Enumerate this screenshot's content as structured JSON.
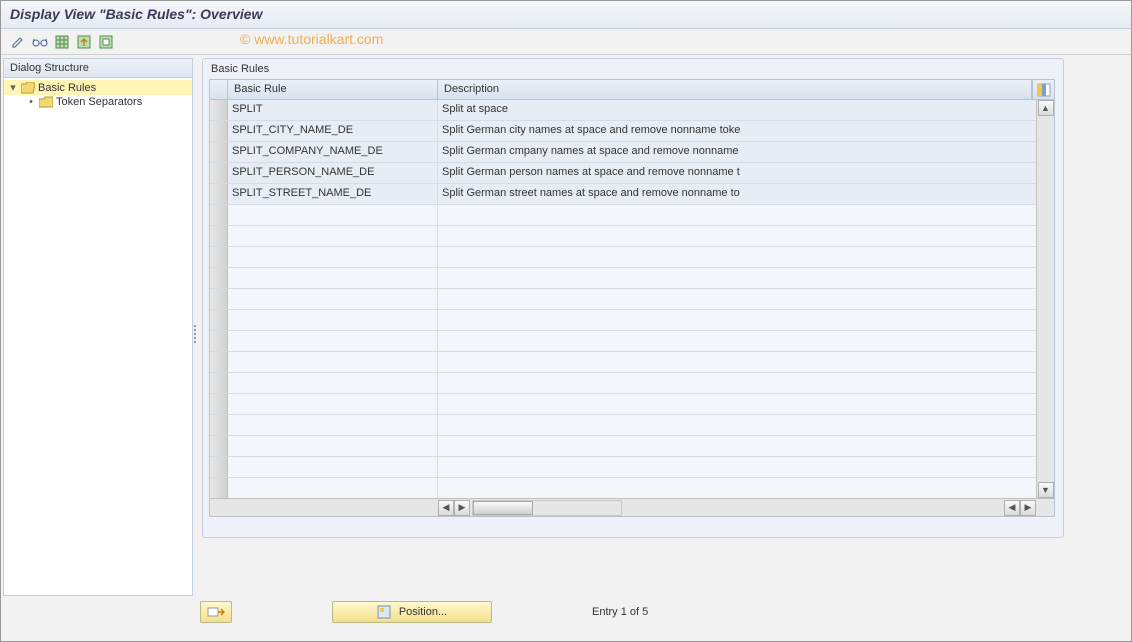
{
  "title": "Display View \"Basic Rules\": Overview",
  "watermark": "© www.tutorialkart.com",
  "toolbar_icons": [
    "edit-icon",
    "glasses-icon",
    "table-select-icon",
    "table-export-icon",
    "table-settings-icon"
  ],
  "tree": {
    "header": "Dialog Structure",
    "nodes": [
      {
        "label": "Basic Rules",
        "expanded": true,
        "selected": true,
        "icon": "folder-open"
      },
      {
        "label": "Token Separators",
        "child": true,
        "icon": "folder-closed"
      }
    ]
  },
  "grid": {
    "title": "Basic Rules",
    "columns": [
      "Basic Rule",
      "Description"
    ],
    "rows": [
      {
        "rule": "SPLIT",
        "desc": "Split at space"
      },
      {
        "rule": "SPLIT_CITY_NAME_DE",
        "desc": "Split German city names at space and remove nonname toke"
      },
      {
        "rule": "SPLIT_COMPANY_NAME_DE",
        "desc": "Split German cmpany names at space and remove nonname"
      },
      {
        "rule": "SPLIT_PERSON_NAME_DE",
        "desc": "Split German person names at space and remove nonname t"
      },
      {
        "rule": "SPLIT_STREET_NAME_DE",
        "desc": "Split German street names at space and remove nonname to"
      }
    ],
    "empty_rows": 14
  },
  "footer": {
    "position_label": "Position...",
    "entry_label": "Entry 1 of 5"
  }
}
